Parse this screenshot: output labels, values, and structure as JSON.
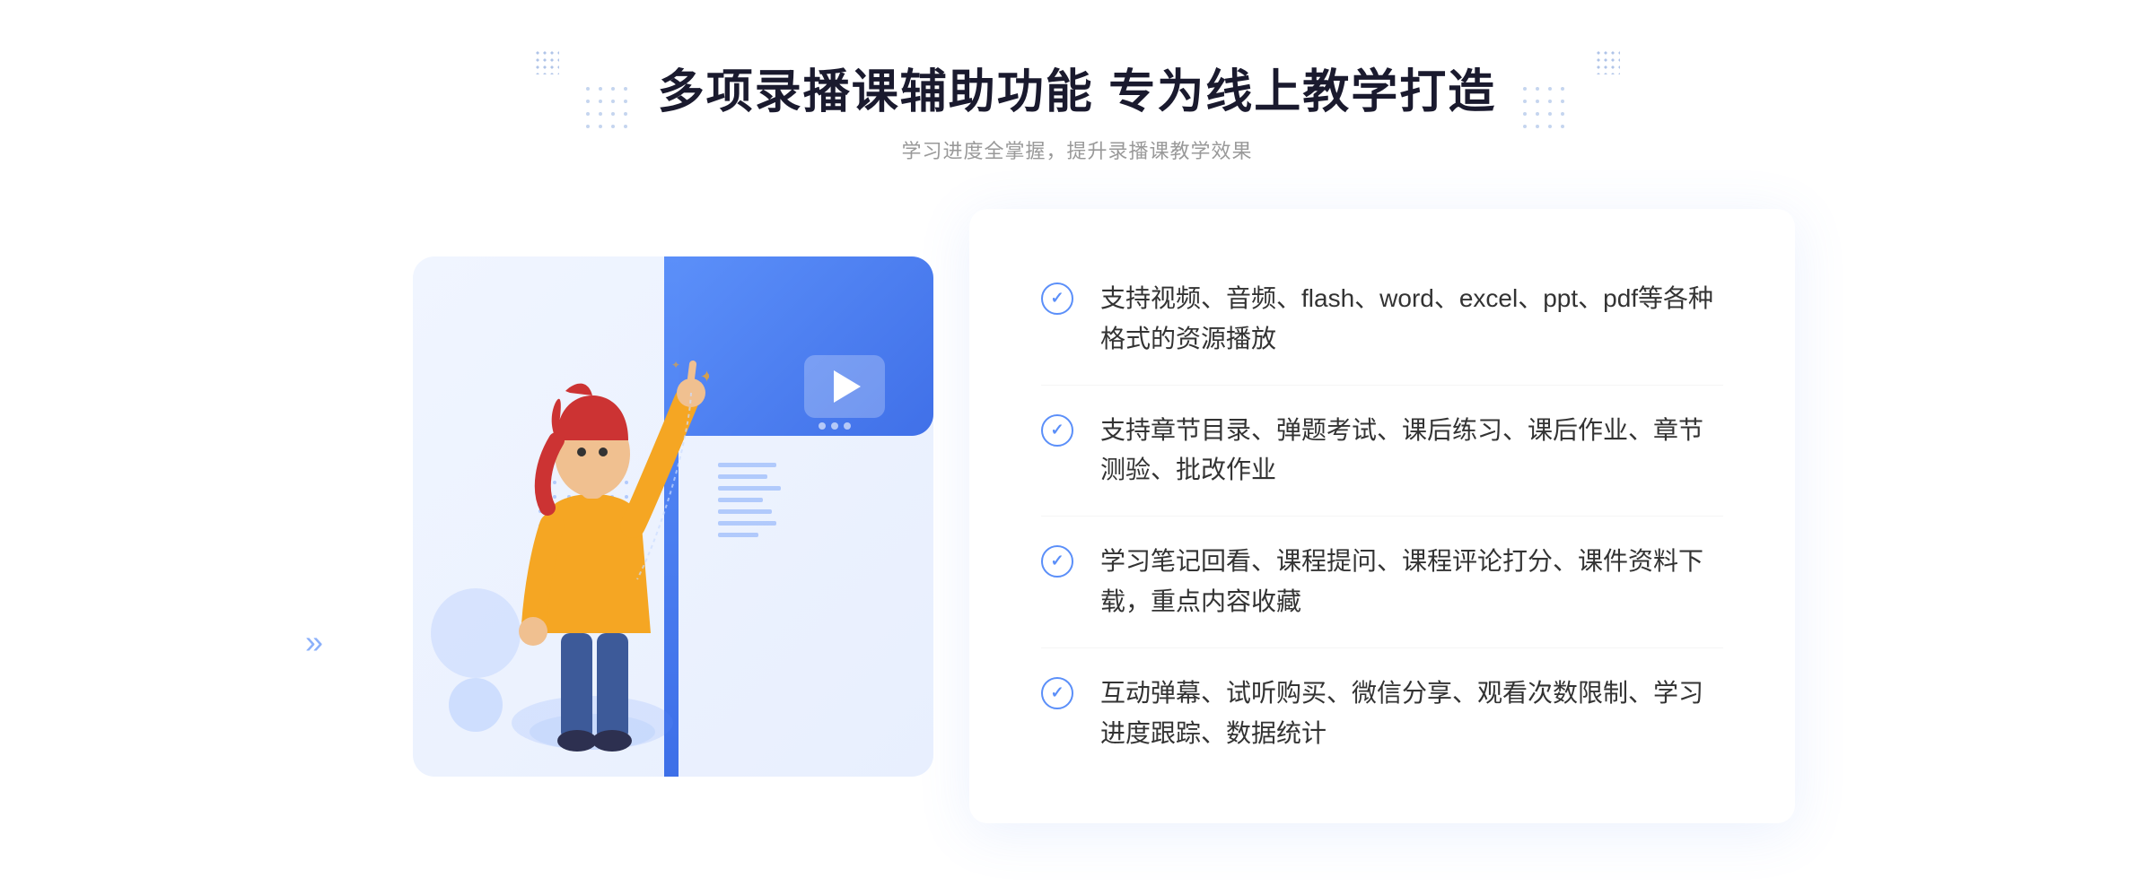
{
  "header": {
    "dots_left_label": "decorative-dots-left",
    "dots_right_label": "decorative-dots-right",
    "main_title": "多项录播课辅助功能 专为线上教学打造",
    "sub_title": "学习进度全掌握，提升录播课教学效果"
  },
  "features": [
    {
      "id": 1,
      "text": "支持视频、音频、flash、word、excel、ppt、pdf等各种格式的资源播放"
    },
    {
      "id": 2,
      "text": "支持章节目录、弹题考试、课后练习、课后作业、章节测验、批改作业"
    },
    {
      "id": 3,
      "text": "学习笔记回看、课程提问、课程评论打分、课件资料下载，重点内容收藏"
    },
    {
      "id": 4,
      "text": "互动弹幕、试听购买、微信分享、观看次数限制、学习进度跟踪、数据统计"
    }
  ],
  "colors": {
    "primary_blue": "#5b8ff9",
    "dark_blue": "#3d6fe8",
    "title_color": "#1a1a2e",
    "text_color": "#333333",
    "subtitle_color": "#999999"
  },
  "icons": {
    "play": "▶",
    "check": "✓",
    "arrows_left": "»",
    "arrows_right": "«"
  }
}
